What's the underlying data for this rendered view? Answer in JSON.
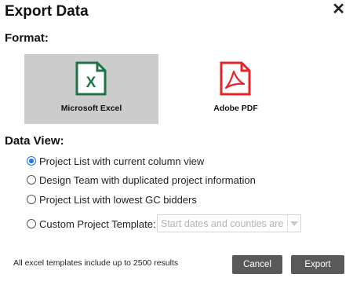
{
  "dialog": {
    "title": "Export Data",
    "close_icon": "close-icon"
  },
  "format": {
    "label": "Format:",
    "options": [
      {
        "label": "Microsoft Excel",
        "icon": "excel-file-icon",
        "color": "#217346",
        "selected": true
      },
      {
        "label": "Adobe PDF",
        "icon": "pdf-file-icon",
        "color": "#e5252a",
        "selected": false
      }
    ]
  },
  "data_view": {
    "label": "Data View:",
    "options": [
      {
        "label": "Project List with current column view",
        "checked": true
      },
      {
        "label": "Design Team with duplicated project information",
        "checked": false
      },
      {
        "label": "Project List with lowest GC bidders",
        "checked": false
      },
      {
        "label": "Custom Project Template:",
        "checked": false
      }
    ],
    "template_select": {
      "value": "Start dates and counties are",
      "disabled": true
    }
  },
  "footer": {
    "note": "All excel templates include up to 2500 results",
    "cancel_label": "Cancel",
    "export_label": "Export"
  },
  "colors": {
    "accent": "#1a73e8",
    "button_bg": "#595959",
    "selected_bg": "#cccccc"
  }
}
